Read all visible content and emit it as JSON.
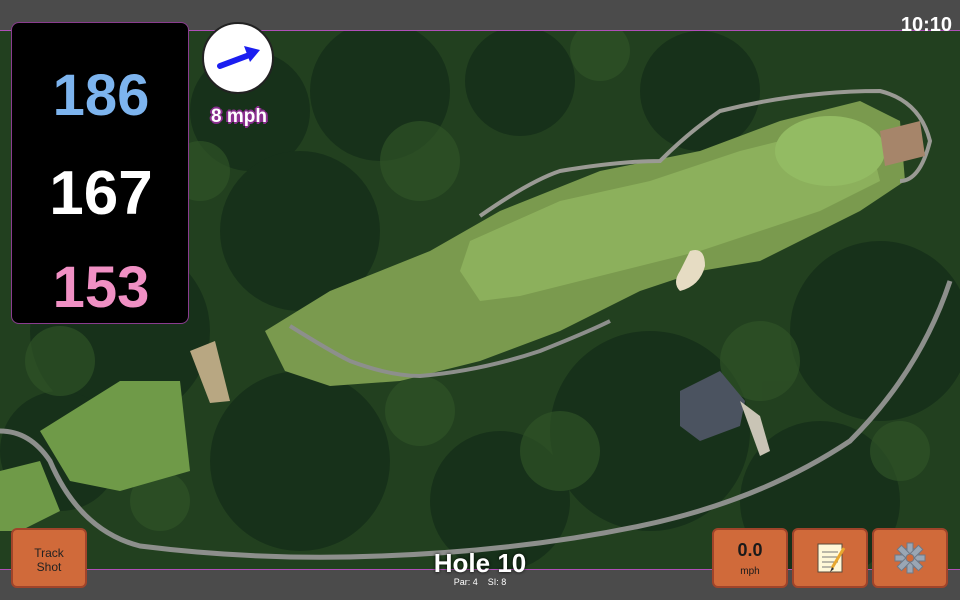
{
  "status": {
    "time": "10:10"
  },
  "distances": {
    "back": "186",
    "middle": "167",
    "front": "153"
  },
  "wind": {
    "indicator_icon": "wind-arrow-icon",
    "speed_label": "8 mph"
  },
  "buttons": {
    "track_shot": {
      "line1": "Track",
      "line2": "Shot"
    },
    "wind": {
      "value": "0.0",
      "unit": "mph"
    },
    "notes": {
      "icon": "notepad-icon"
    },
    "settings": {
      "icon": "gear-icon"
    }
  },
  "hole": {
    "title": "Hole 10",
    "par": "Par: 4",
    "si": "SI: 8"
  },
  "colors": {
    "back": "#7db4ee",
    "middle": "#ffffff",
    "front": "#f090c4",
    "button": "#d06a3a",
    "accent": "#b04fb8"
  }
}
